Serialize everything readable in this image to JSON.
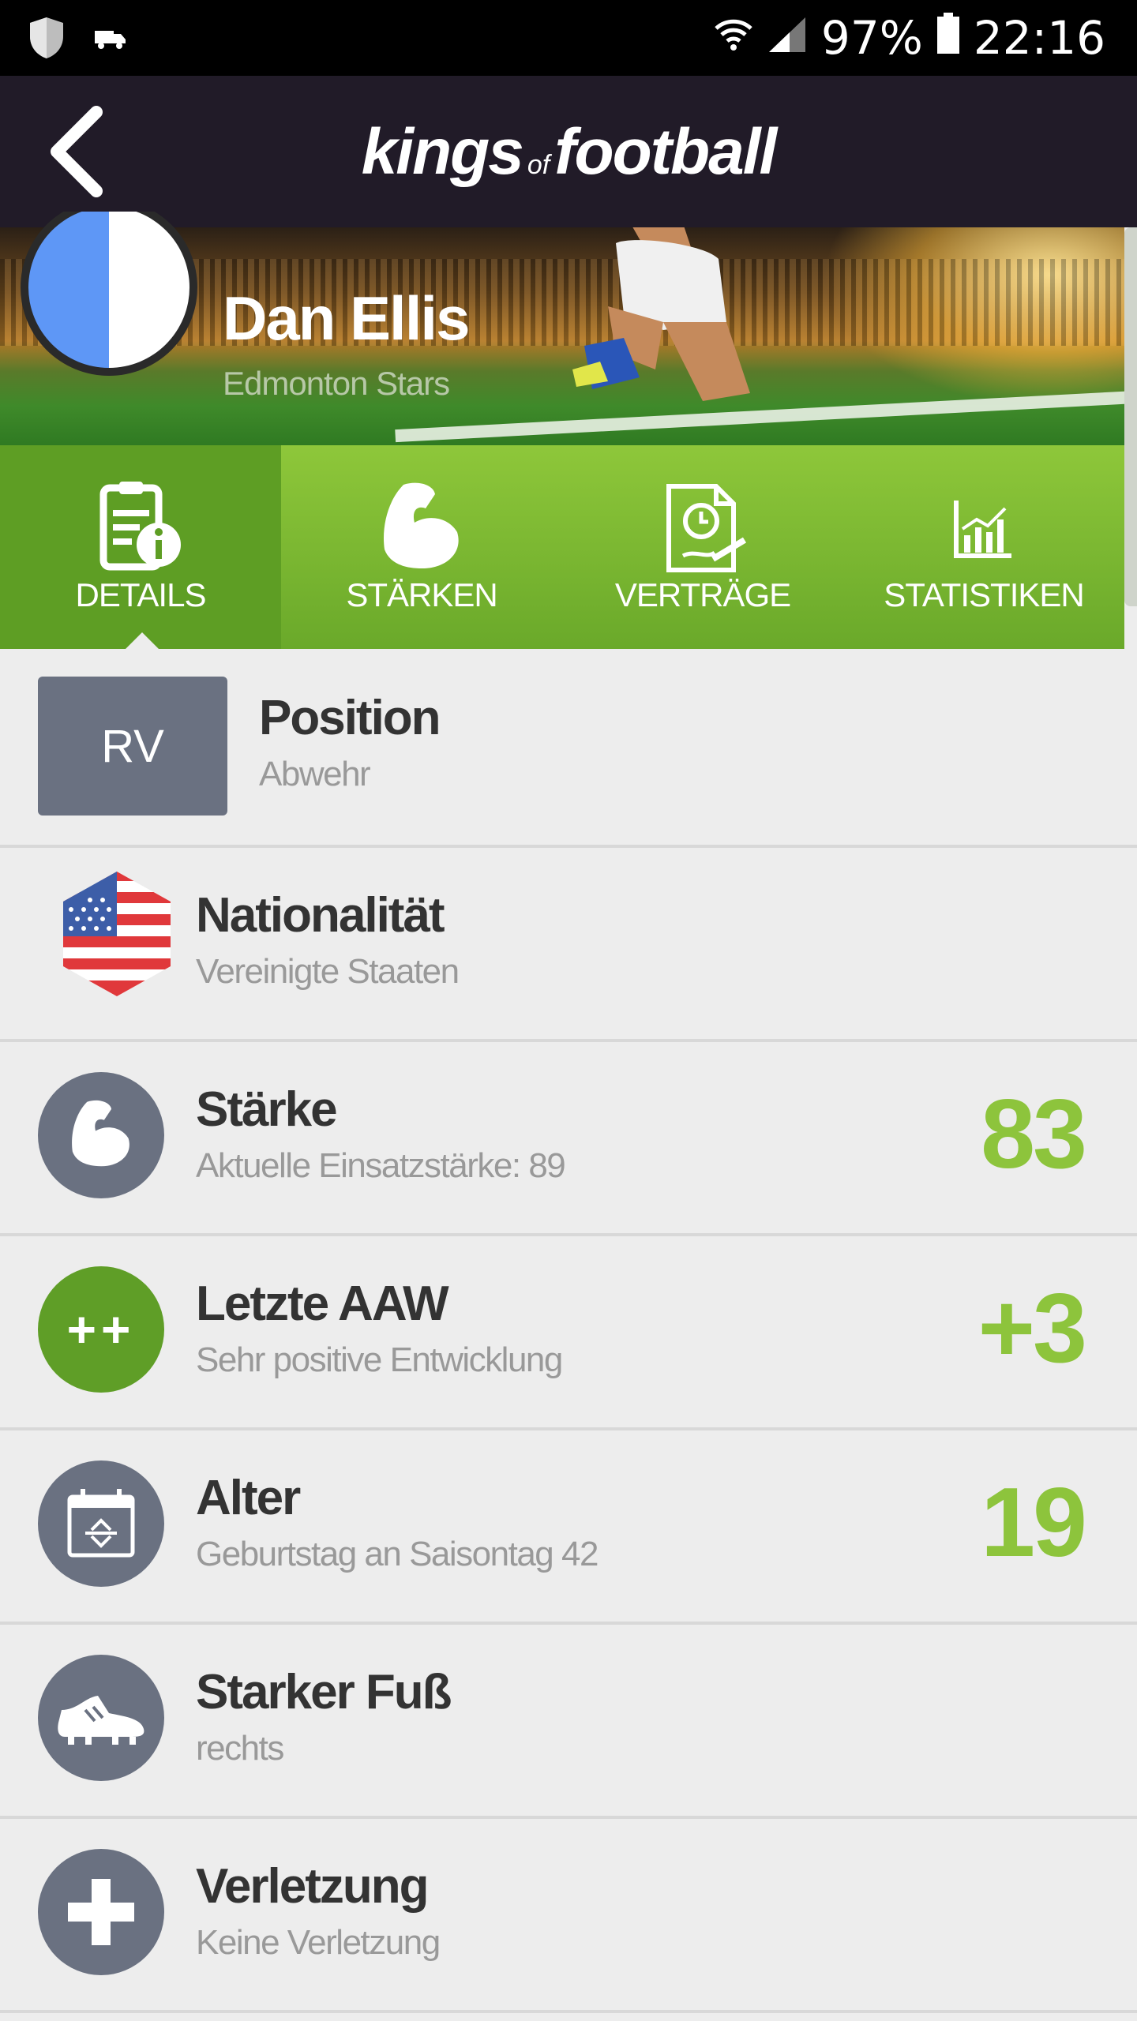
{
  "status": {
    "battery": "97%",
    "time": "22:16"
  },
  "app": {
    "brand_left": "kings",
    "brand_of": "of",
    "brand_right": "football"
  },
  "player": {
    "name": "Dan Ellis",
    "club": "Edmonton Stars"
  },
  "tabs": [
    {
      "label": "DETAILS",
      "icon": "details-info-icon",
      "active": true
    },
    {
      "label": "STÄRKEN",
      "icon": "flexed-bicep-icon",
      "active": false
    },
    {
      "label": "VERTRÄGE",
      "icon": "contract-icon",
      "active": false
    },
    {
      "label": "STATISTIKEN",
      "icon": "bar-chart-icon",
      "active": false
    }
  ],
  "details": {
    "position": {
      "badge": "RV",
      "title": "Position",
      "sub": "Abwehr"
    },
    "nationality": {
      "title": "Nationalität",
      "sub": "Vereinigte Staaten",
      "icon": "us-flag-icon"
    },
    "strength": {
      "title": "Stärke",
      "sub": "Aktuelle Einsatzstärke: 89",
      "value": "83",
      "icon": "bicep-icon"
    },
    "development": {
      "title": "Letzte AAW",
      "sub": "Sehr positive Entwicklung",
      "value": "+3",
      "icon_text": "++"
    },
    "age": {
      "title": "Alter",
      "sub": "Geburtstag an Saisontag 42",
      "value": "19",
      "icon": "calendar-icon"
    },
    "foot": {
      "title": "Starker Fuß",
      "sub": "rechts",
      "icon": "football-boot-icon"
    },
    "injury": {
      "title": "Verletzung",
      "sub": "Keine Verletzung",
      "icon": "medical-cross-icon"
    }
  },
  "colors": {
    "accent_green": "#8dc43c",
    "tab_green": "#6aa92a",
    "appbar": "#211b28",
    "icon_gray": "#6a7181"
  }
}
